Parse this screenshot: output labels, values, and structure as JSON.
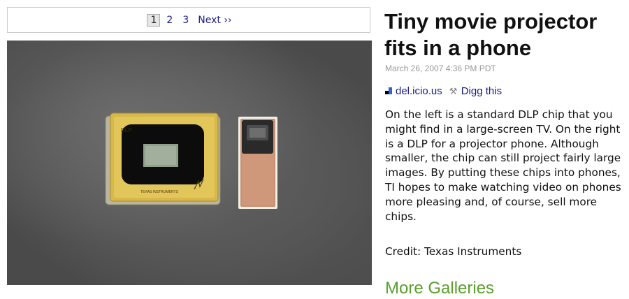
{
  "pager": {
    "pages": [
      "1",
      "2",
      "3"
    ],
    "current": "1",
    "next_label": "Next ››"
  },
  "article": {
    "title": "Tiny movie projector fits in a phone",
    "date": "March 26, 2007 4:36 PM PDT",
    "social": {
      "delicious_label": "del.icio.us",
      "digg_label": "Digg this"
    },
    "body": "On the left is a standard DLP chip that you might find in a large-screen TV. On the right is a DLP for a projector phone. Although smaller, the chip can still project fairly large images. By putting these chips into phones, TI hopes to make watching video on phones more pleasing and, of course, sell more chips.",
    "credit": "Credit: Texas Instruments",
    "more_galleries": "More Galleries"
  },
  "photo": {
    "large_chip_logo": "DLP",
    "large_chip_maker": "TEXAS INSTRUMENTS"
  },
  "colors": {
    "link": "#1a1a8c",
    "date": "#999999",
    "more_galleries": "#5aa02c",
    "chip_gold": "#d8b84a"
  }
}
